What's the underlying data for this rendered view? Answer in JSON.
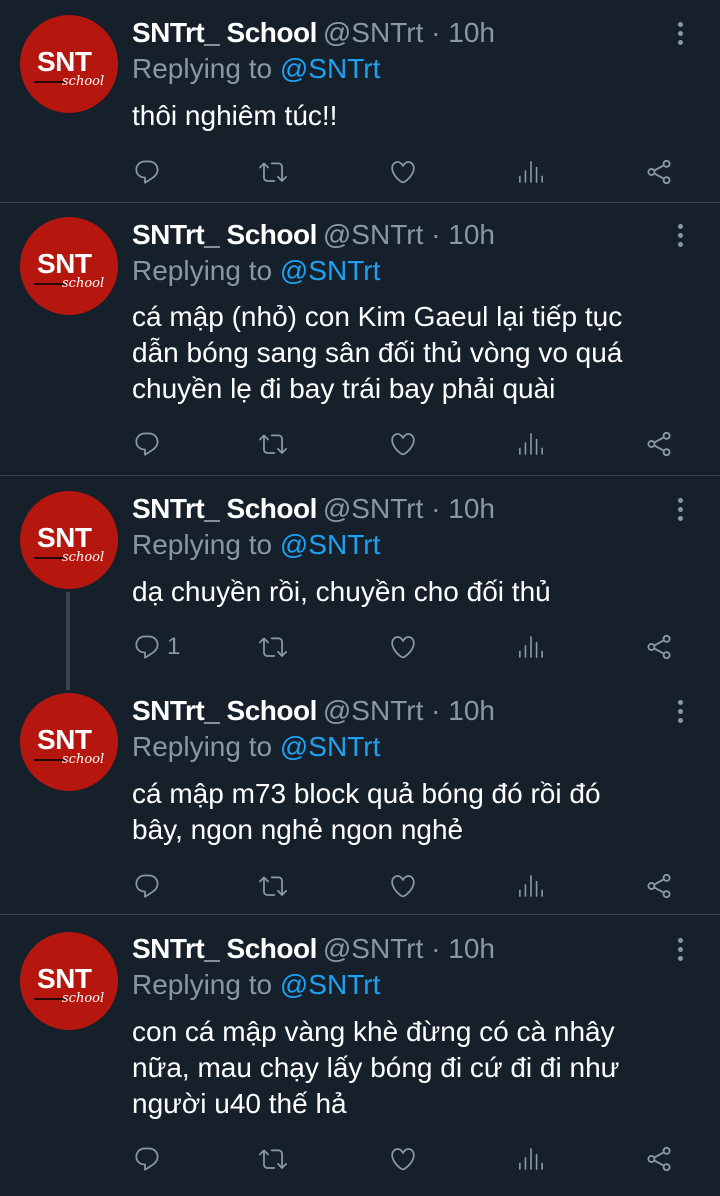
{
  "tweets": [
    {
      "name": "SNTrt_ School",
      "handle": "@SNTrt",
      "time": "10h",
      "replying_prefix": "Replying to",
      "replying_handle": "@SNTrt",
      "text": "thôi nghiêm túc!!",
      "reply_count": ""
    },
    {
      "name": "SNTrt_ School",
      "handle": "@SNTrt",
      "time": "10h",
      "replying_prefix": "Replying to",
      "replying_handle": "@SNTrt",
      "text": "cá mập (nhỏ) con Kim Gaeul lại tiếp tục\ndẫn bóng sang sân đối thủ vòng vo quá\nchuyền lẹ đi bay trái bay phải quài",
      "reply_count": ""
    },
    {
      "name": "SNTrt_ School",
      "handle": "@SNTrt",
      "time": "10h",
      "replying_prefix": "Replying to",
      "replying_handle": "@SNTrt",
      "text": "dạ chuyền rồi, chuyền cho đối thủ",
      "reply_count": "1"
    },
    {
      "name": "SNTrt_ School",
      "handle": "@SNTrt",
      "time": "10h",
      "replying_prefix": "Replying to",
      "replying_handle": "@SNTrt",
      "text": "cá mập m73 block quả bóng đó rồi đó\nbây, ngon nghẻ ngon nghẻ",
      "reply_count": ""
    },
    {
      "name": "SNTrt_ School",
      "handle": "@SNTrt",
      "time": "10h",
      "replying_prefix": "Replying to",
      "replying_handle": "@SNTrt",
      "text": "con cá mập vàng khè đừng có cà nhây\nnữa, mau chạy lấy bóng đi cứ đi đi như\nngười u40 thế hả",
      "reply_count": ""
    }
  ],
  "avatar": {
    "logo_text": "SNT",
    "logo_subtext": "school",
    "color": "#b5170f"
  },
  "icons": [
    "reply-icon",
    "retweet-icon",
    "like-icon",
    "analytics-icon",
    "share-icon",
    "more-icon"
  ],
  "colors": {
    "background": "#15202b",
    "divider": "#38444d",
    "muted": "#8899a6",
    "link": "#1da1f2",
    "text": "#ffffff"
  }
}
